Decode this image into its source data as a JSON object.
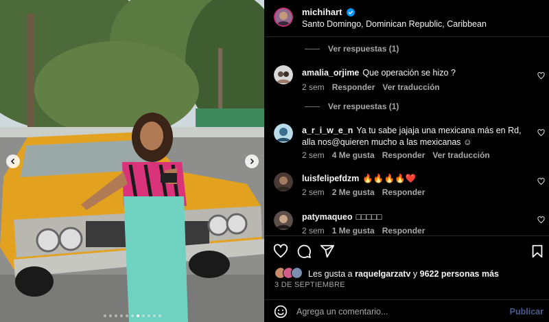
{
  "post": {
    "username": "michihart",
    "verified": true,
    "location": "Santo Domingo, Dominican Republic, Caribbean",
    "carousel": {
      "slide_count": 11,
      "active_slide": 7
    }
  },
  "comments": [
    {
      "type": "replies",
      "label": "Ver respuestas (1)"
    },
    {
      "type": "comment",
      "user": "amalia_orjime",
      "text": "Que operación se hizo ?",
      "time": "2 sem",
      "likes": "",
      "reply": "Responder",
      "translate": "Ver traducción"
    },
    {
      "type": "replies",
      "label": "Ver respuestas (1)"
    },
    {
      "type": "comment",
      "user": "a_r_i_w_e_n",
      "text": "Ya tu sabe jajaja una mexicana más en Rd, alla nos@quieren mucho a las mexicanas ☺",
      "time": "2 sem",
      "likes": "4 Me gusta",
      "reply": "Responder",
      "translate": "Ver traducción"
    },
    {
      "type": "comment",
      "user": "luisfelipefdzm",
      "text": "🔥🔥🔥🔥❤️",
      "time": "2 sem",
      "likes": "2 Me gusta",
      "reply": "Responder",
      "translate": ""
    },
    {
      "type": "comment",
      "user": "patymaqueo",
      "text": "□□□□□",
      "time": "2 sem",
      "likes": "1 Me gusta",
      "reply": "Responder",
      "translate": ""
    }
  ],
  "likes": {
    "prefix": "Les gusta a",
    "user": "raquelgarzatv",
    "suffix": "y",
    "count_text": "9622 personas más"
  },
  "date": "3 DE SEPTIEMBRE",
  "composer": {
    "placeholder": "Agrega un comentario...",
    "post_label": "Publicar"
  },
  "icons": {
    "like": "heart-icon",
    "comment": "comment-icon",
    "share": "share-icon",
    "save": "bookmark-icon",
    "emoji": "emoji-icon"
  },
  "colors": {
    "verified": "#0095f6",
    "muted_text": "#a8a8a8",
    "post_button_disabled": "#4a5d8a"
  }
}
